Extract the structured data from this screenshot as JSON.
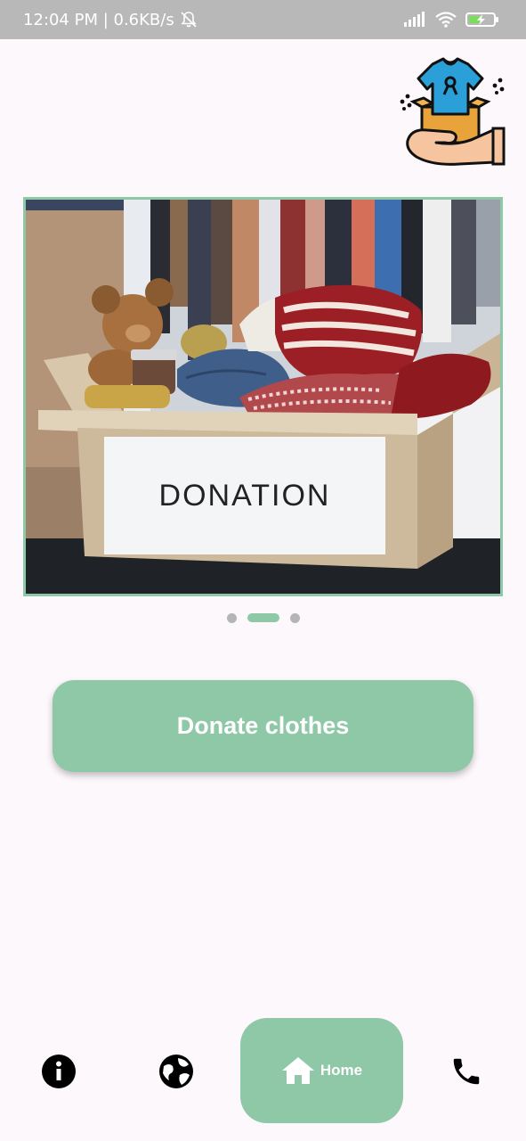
{
  "status_bar": {
    "time_speed": "12:04 PM | 0.6KB/s",
    "icons": [
      "mute-bell-icon",
      "signal-icon",
      "wifi-icon",
      "battery-charging-icon"
    ]
  },
  "header": {
    "logo_icon": "clothes-donation-logo"
  },
  "carousel": {
    "box_label": "DONATION",
    "page_count": 3,
    "active_index": 1
  },
  "main": {
    "donate_label": "Donate clothes"
  },
  "bottom_nav": {
    "items": [
      {
        "icon": "info-icon"
      },
      {
        "icon": "globe-icon"
      },
      {
        "icon": "home-icon",
        "label": "Home",
        "active": true
      },
      {
        "icon": "phone-icon"
      }
    ]
  },
  "colors": {
    "accent": "#8fc8a7",
    "status_bar": "#b8b8b8",
    "background": "#fdf8fc"
  }
}
